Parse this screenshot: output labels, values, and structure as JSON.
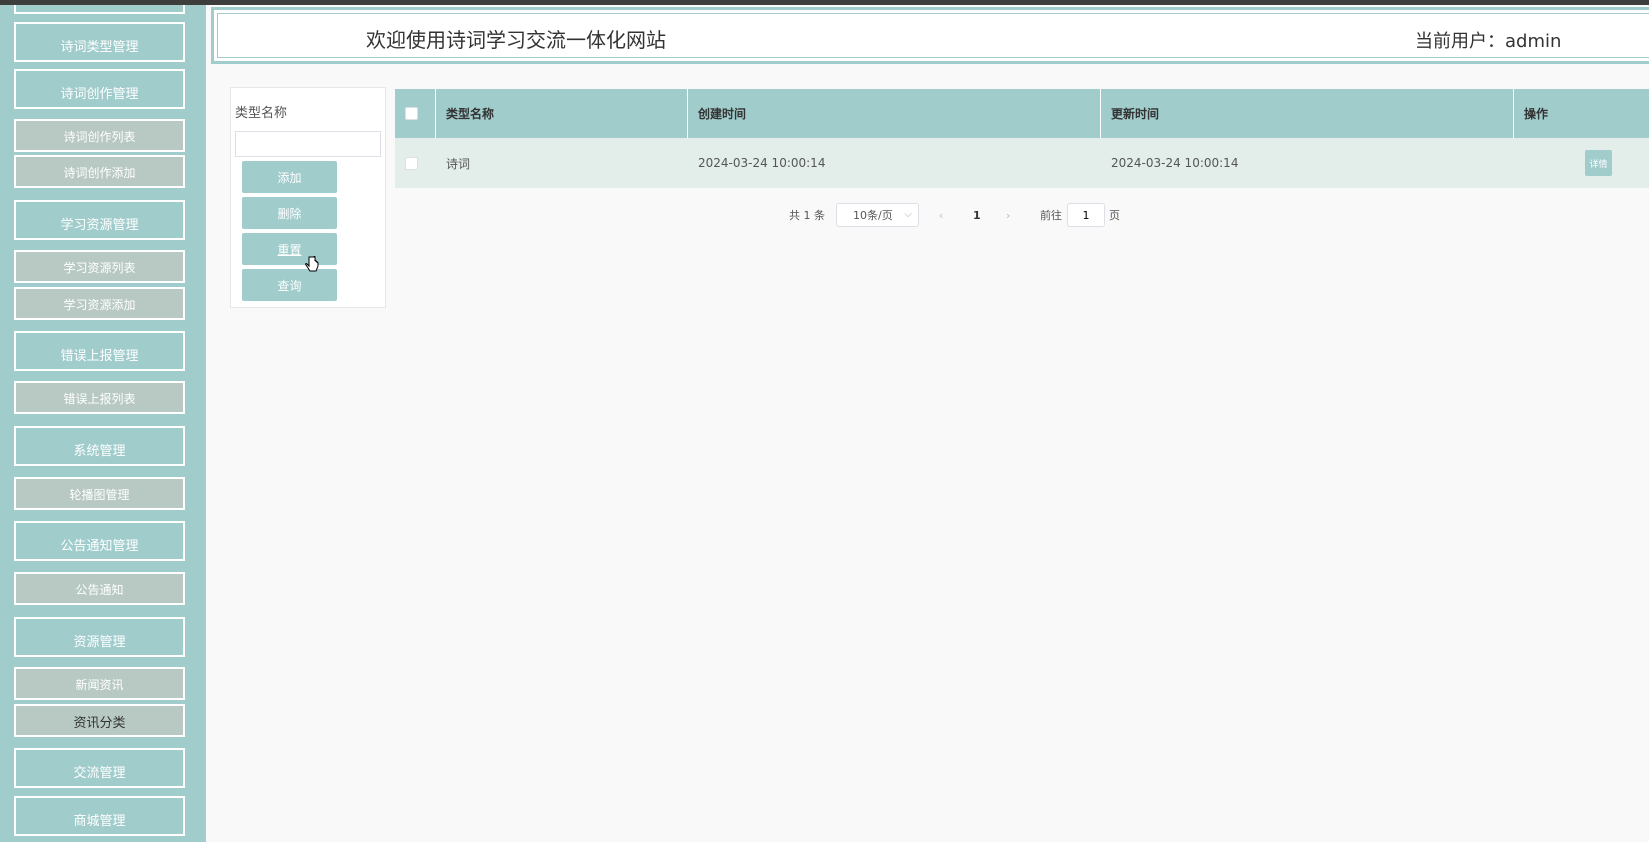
{
  "header": {
    "title": "欢迎使用诗词学习交流一体化网站",
    "user_label": "当前用户：admin"
  },
  "sidebar": {
    "items": [
      {
        "label": "",
        "type": "parent"
      },
      {
        "label": "诗词类型管理",
        "type": "parent"
      },
      {
        "label": "诗词创作管理",
        "type": "parent"
      },
      {
        "label": "诗词创作列表",
        "type": "child"
      },
      {
        "label": "诗词创作添加",
        "type": "child"
      },
      {
        "label": "学习资源管理",
        "type": "parent"
      },
      {
        "label": "学习资源列表",
        "type": "child"
      },
      {
        "label": "学习资源添加",
        "type": "child"
      },
      {
        "label": "错误上报管理",
        "type": "parent"
      },
      {
        "label": "错误上报列表",
        "type": "child"
      },
      {
        "label": "系统管理",
        "type": "parent"
      },
      {
        "label": "轮播图管理",
        "type": "child"
      },
      {
        "label": "公告通知管理",
        "type": "parent"
      },
      {
        "label": "公告通知",
        "type": "child"
      },
      {
        "label": "资源管理",
        "type": "parent"
      },
      {
        "label": "新闻资讯",
        "type": "child"
      },
      {
        "label": "资讯分类",
        "type": "child",
        "active": true
      },
      {
        "label": "交流管理",
        "type": "parent"
      },
      {
        "label": "商城管理",
        "type": "parent"
      }
    ]
  },
  "search": {
    "label": "类型名称",
    "value": "",
    "buttons": {
      "add": "添加",
      "delete": "删除",
      "reset": "重置",
      "query": "查询"
    }
  },
  "table": {
    "headers": {
      "type_name": "类型名称",
      "created": "创建时间",
      "updated": "更新时间",
      "actions": "操作"
    },
    "rows": [
      {
        "type_name": "诗词",
        "created": "2024-03-24 10:00:14",
        "updated": "2024-03-24 10:00:14",
        "action": "详情"
      }
    ]
  },
  "pagination": {
    "total": "共 1 条",
    "page_size": "10条/页",
    "current_page": "1",
    "goto_label": "前往",
    "goto_value": "1",
    "page_suffix": "页"
  },
  "colors": {
    "accent": "#a1cccc",
    "child_nav": "#b8c9c4",
    "row_bg": "#e3eeeb"
  }
}
